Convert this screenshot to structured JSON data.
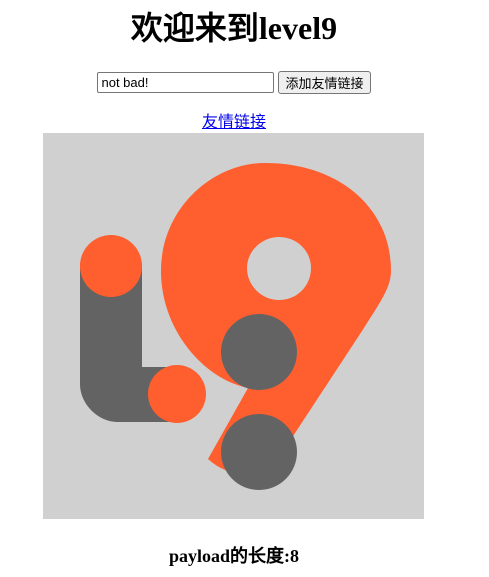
{
  "page": {
    "title": "欢迎来到level9"
  },
  "form": {
    "input_value": "not bad!",
    "submit_label": "添加友情链接"
  },
  "friend_link": {
    "label": "友情链接"
  },
  "logo": {
    "icon": "level9-logo-icon",
    "colors": {
      "background": "#d0d0d0",
      "orange": "#ff5e2e",
      "gray": "#636363"
    }
  },
  "footer": {
    "payload_length_text": "payload的长度:8"
  }
}
